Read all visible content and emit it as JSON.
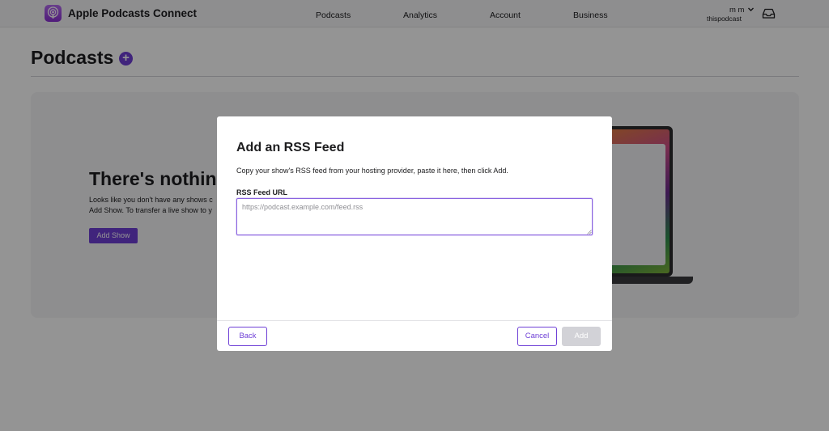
{
  "header": {
    "app_name": "Apple Podcasts Connect",
    "nav": [
      "Podcasts",
      "Analytics",
      "Account",
      "Business"
    ],
    "user_name": "m m",
    "provider": "thispodcast",
    "icons": {
      "logo": "podcasts-logo-icon",
      "user_menu": "chevron-down-icon",
      "inbox": "inbox-icon"
    }
  },
  "page": {
    "title": "Podcasts",
    "add_icon": "plus-circle-icon",
    "empty_state": {
      "heading": "There's nothing",
      "text_line_1": "Looks like you don't have any shows c",
      "text_line_2": "Add Show. To transfer a live show to y",
      "button": "Add Show"
    }
  },
  "modal": {
    "title": "Add an RSS Feed",
    "description": "Copy your show's RSS feed from your hosting provider, paste it here, then click Add.",
    "field_label": "RSS Feed URL",
    "field_placeholder": "https://podcast.example.com/feed.rss",
    "field_value": "",
    "back_label": "Back",
    "cancel_label": "Cancel",
    "add_label": "Add",
    "add_enabled": false
  },
  "colors": {
    "accent": "#6e3fd6",
    "disabled": "#d2d2d7",
    "overlay": "rgba(0,0,0,0.42)"
  }
}
